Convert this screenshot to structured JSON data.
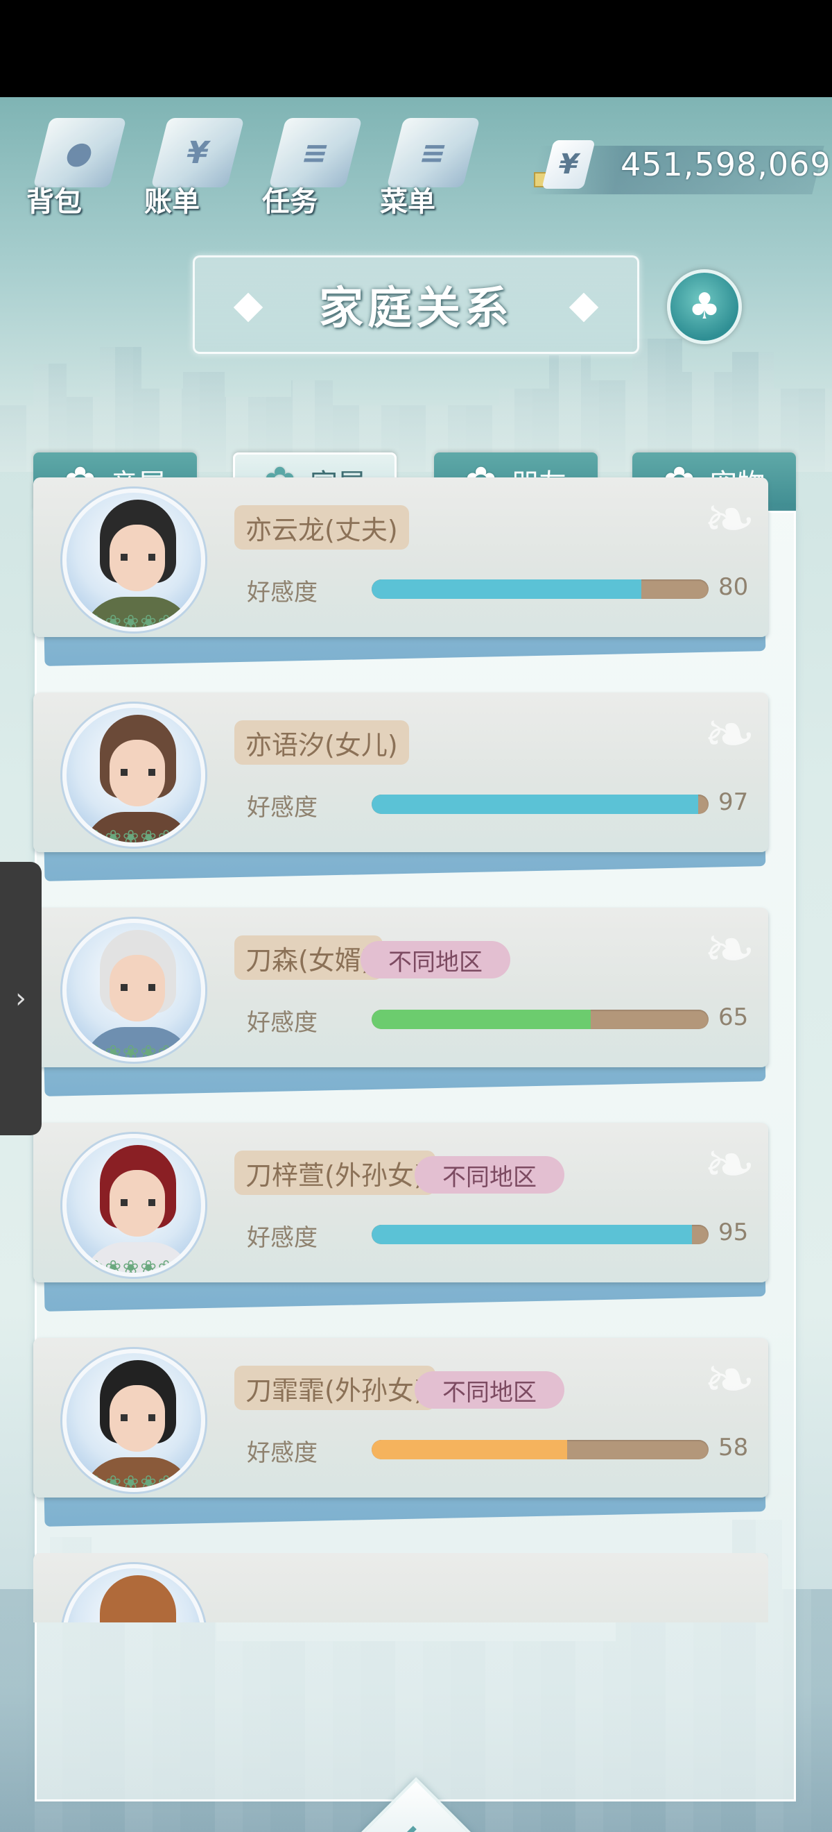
{
  "top_menu": [
    {
      "label": "背包",
      "icon": "bag-icon",
      "glyph": "●"
    },
    {
      "label": "账单",
      "icon": "bill-icon",
      "glyph": "¥"
    },
    {
      "label": "任务",
      "icon": "task-icon",
      "glyph": "≡"
    },
    {
      "label": "菜单",
      "icon": "menu-icon",
      "glyph": "≡"
    }
  ],
  "currency": {
    "symbol": "¥",
    "value": "451,598,069"
  },
  "title": "家庭关系",
  "tabs": [
    {
      "label": "亲属",
      "active": false
    },
    {
      "label": "家属",
      "active": true
    },
    {
      "label": "朋友",
      "active": false
    },
    {
      "label": "宠物",
      "active": false
    }
  ],
  "affinity_label": "好感度",
  "members": [
    {
      "name": "亦云龙(丈夫)",
      "region": "",
      "affinity": 80,
      "affinity_text": "80",
      "bar_color": "#5bc2d6",
      "hair": "#2a2a2a",
      "clothes": "#5f6f46"
    },
    {
      "name": "亦语汐(女儿)",
      "region": "",
      "affinity": 97,
      "affinity_text": "97",
      "bar_color": "#5bc2d6",
      "hair": "#6b4a38",
      "clothes": "#6a4634"
    },
    {
      "name": "刀森(女婿)",
      "region": "不同地区",
      "affinity": 65,
      "affinity_text": "65",
      "bar_color": "#6ccc6e",
      "hair": "#e2e2e2",
      "clothes": "#6e8fb0"
    },
    {
      "name": "刀梓萱(外孙女)",
      "region": "不同地区",
      "affinity": 95,
      "affinity_text": "95",
      "bar_color": "#5bc2d6",
      "hair": "#8a1f24",
      "clothes": "#e8e8ec"
    },
    {
      "name": "刀霏霏(外孙女)",
      "region": "不同地区",
      "affinity": 58,
      "affinity_text": "58",
      "bar_color": "#f5b35d",
      "hair": "#222222",
      "clothes": "#8a5a3a"
    }
  ],
  "partial_card": {
    "hair": "#b06a3a"
  }
}
